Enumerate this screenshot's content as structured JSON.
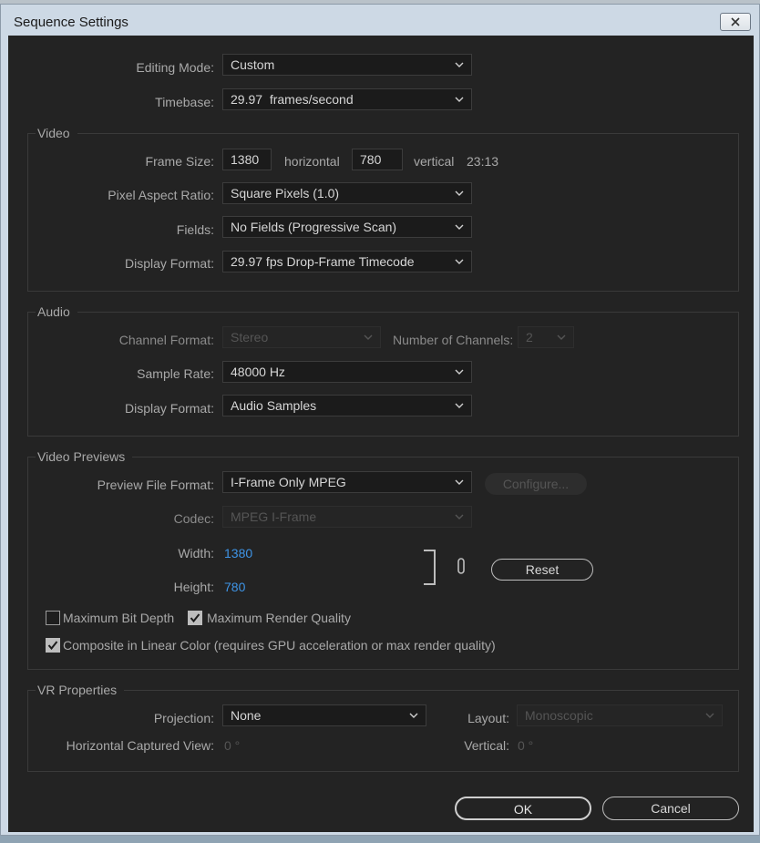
{
  "window": {
    "title": "Sequence Settings"
  },
  "general": {
    "editing_mode_label": "Editing Mode:",
    "editing_mode_value": "Custom",
    "timebase_label": "Timebase:",
    "timebase_value": "29.97  frames/second"
  },
  "video": {
    "group_title": "Video",
    "frame_size_label": "Frame Size:",
    "frame_width": "1380",
    "horizontal_label": "horizontal",
    "frame_height": "780",
    "vertical_label": "vertical",
    "aspect_ratio": "23:13",
    "pixel_aspect_label": "Pixel Aspect Ratio:",
    "pixel_aspect_value": "Square Pixels (1.0)",
    "fields_label": "Fields:",
    "fields_value": "No Fields (Progressive Scan)",
    "display_format_label": "Display Format:",
    "display_format_value": "29.97 fps Drop-Frame Timecode"
  },
  "audio": {
    "group_title": "Audio",
    "channel_format_label": "Channel Format:",
    "channel_format_value": "Stereo",
    "num_channels_label": "Number of Channels:",
    "num_channels_value": "2",
    "sample_rate_label": "Sample Rate:",
    "sample_rate_value": "48000 Hz",
    "display_format_label": "Display Format:",
    "display_format_value": "Audio Samples"
  },
  "previews": {
    "group_title": "Video Previews",
    "preview_format_label": "Preview File Format:",
    "preview_format_value": "I-Frame Only MPEG",
    "configure_label": "Configure...",
    "codec_label": "Codec:",
    "codec_value": "MPEG I-Frame",
    "width_label": "Width:",
    "width_value": "1380",
    "height_label": "Height:",
    "height_value": "780",
    "reset_label": "Reset",
    "max_bit_depth_label": "Maximum Bit Depth",
    "max_render_quality_label": "Maximum Render Quality",
    "composite_linear_label": "Composite in Linear Color (requires GPU acceleration or max render quality)"
  },
  "vr": {
    "group_title": "VR Properties",
    "projection_label": "Projection:",
    "projection_value": "None",
    "layout_label": "Layout:",
    "layout_value": "Monoscopic",
    "horizontal_view_label": "Horizontal Captured View:",
    "horizontal_view_value": "0 °",
    "vertical_label": "Vertical:",
    "vertical_value": "0 °"
  },
  "footer": {
    "ok_label": "OK",
    "cancel_label": "Cancel"
  },
  "colors": {
    "panel_bg": "#232323",
    "accent_blue": "#3e94e6",
    "text": "#a9a9a9"
  },
  "icons": {
    "chevron": "chevron-down-icon",
    "close": "close-icon",
    "link": "link-icon",
    "check": "checkmark-icon"
  }
}
